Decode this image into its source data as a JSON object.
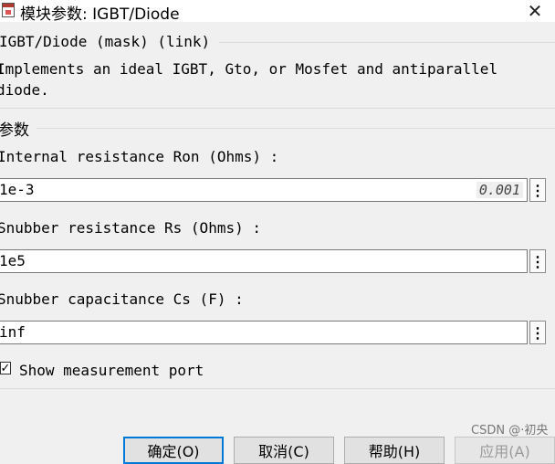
{
  "window": {
    "title": "模块参数: IGBT/Diode",
    "close_glyph": "✕"
  },
  "description": {
    "header": "IGBT/Diode (mask) (link)",
    "line1": "Implements an ideal  IGBT, Gto, or Mosfet and antiparallel",
    "line2": "diode."
  },
  "params": {
    "section_label": "参数",
    "ron": {
      "label": "Internal resistance Ron (Ohms) :",
      "value": "1e-3",
      "evaluated_hint": "0.001"
    },
    "rs": {
      "label": "Snubber resistance Rs (Ohms) :",
      "value": "1e5"
    },
    "cs": {
      "label": "Snubber capacitance Cs (F) :",
      "value": "inf"
    },
    "more_glyph": "⋮",
    "measure": {
      "label": "Show measurement port",
      "checked": true,
      "check_glyph": "✓"
    }
  },
  "buttons": {
    "ok": "确定(O)",
    "cancel": "取消(C)",
    "help": "帮助(H)",
    "apply": "应用(A)"
  },
  "watermark": "CSDN @·初央"
}
